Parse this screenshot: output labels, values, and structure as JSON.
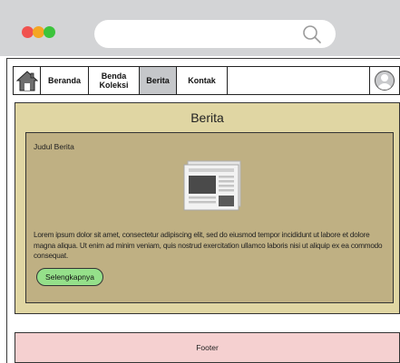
{
  "browser": {
    "address_value": "",
    "colors": {
      "bar": "#d3d4d6",
      "dot_red": "#f0524f",
      "dot_orange": "#f5a623",
      "dot_green": "#3cc43c"
    }
  },
  "nav": {
    "items": [
      {
        "label": "Beranda",
        "active": false
      },
      {
        "label": "Benda Koleksi",
        "active": false
      },
      {
        "label": "Berita",
        "active": true
      },
      {
        "label": "Kontak",
        "active": false
      }
    ],
    "icons": {
      "home": "home-icon",
      "profile": "user-avatar-icon"
    }
  },
  "main": {
    "title": "Berita",
    "background": "#e0d6a3",
    "card": {
      "title": "Judul Berita",
      "body": "Lorem ipsum dolor sit amet, consectetur adipiscing elit, sed do eiusmod tempor incididunt ut labore et dolore magna aliqua. Ut enim ad minim veniam, quis nostrud exercitation ullamco laboris nisi ut aliquip ex ea commodo consequat.",
      "button_label": "Selengkapnya",
      "background": "#bfb083",
      "button_color": "#95e08a"
    }
  },
  "footer": {
    "label": "Footer",
    "background": "#f5d0d0"
  }
}
